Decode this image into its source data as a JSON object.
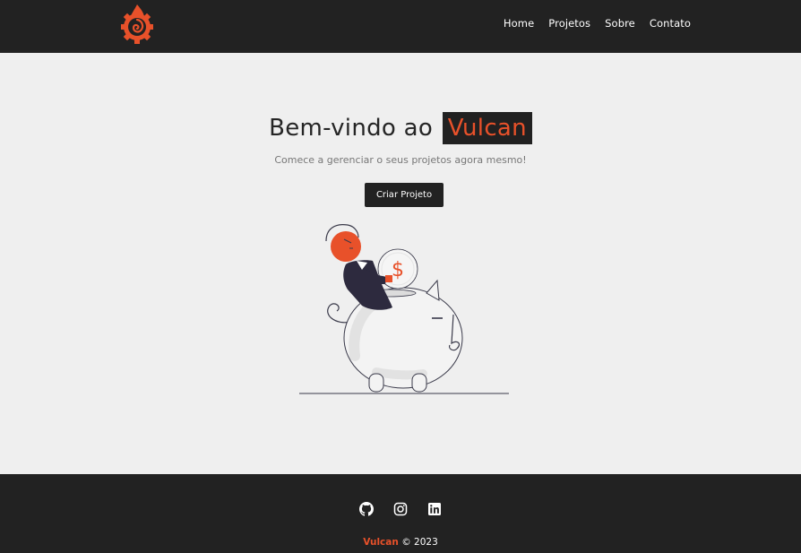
{
  "navbar": {
    "logo_icon": "flame-gear-logo-icon",
    "links": [
      {
        "label": "Home"
      },
      {
        "label": "Projetos"
      },
      {
        "label": "Sobre"
      },
      {
        "label": "Contato"
      }
    ]
  },
  "hero": {
    "title_prefix": "Bem-vindo ao",
    "title_brand": "Vulcan",
    "subtitle": "Comece a gerenciar o seus projetos agora mesmo!",
    "cta_label": "Criar Projeto",
    "illustration_icon": "piggy-bank-savings-illustration",
    "coin_symbol": "$"
  },
  "footer": {
    "socials": [
      {
        "icon": "github-icon"
      },
      {
        "icon": "instagram-icon"
      },
      {
        "icon": "linkedin-icon"
      }
    ],
    "brand": "Vulcan",
    "copyright": "© 2023"
  },
  "colors": {
    "dark": "#222222",
    "accent": "#e8512a",
    "background": "#efefef"
  }
}
